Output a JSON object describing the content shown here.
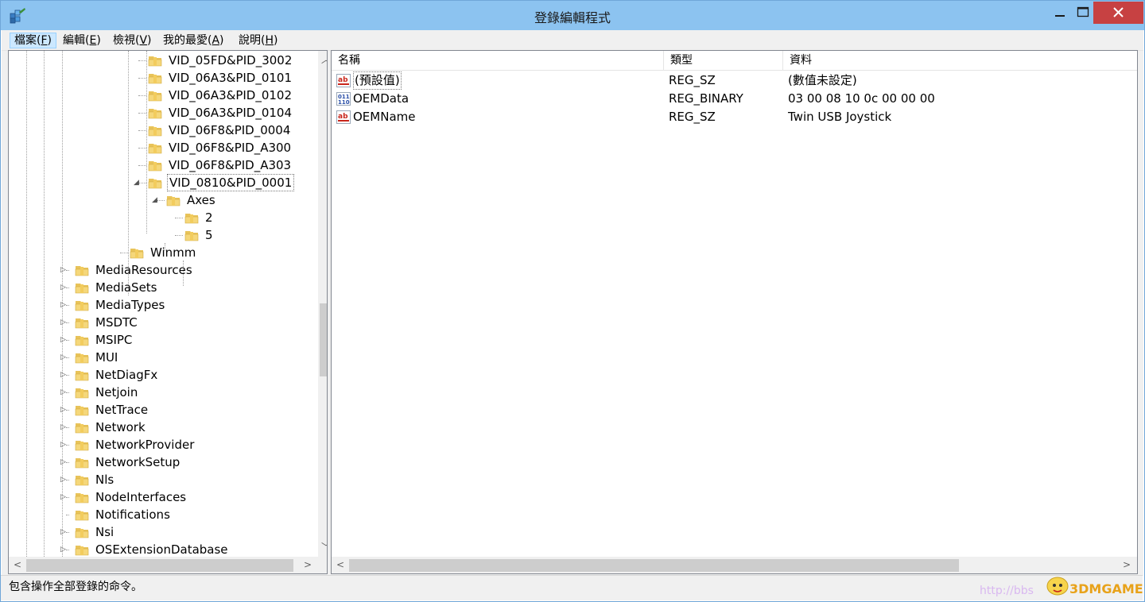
{
  "window": {
    "title": "登錄編輯程式"
  },
  "menu": [
    {
      "label": "檔案(",
      "key": "F",
      "close": ")"
    },
    {
      "label": "編輯(",
      "key": "E",
      "close": ")"
    },
    {
      "label": "檢視(",
      "key": "V",
      "close": ")"
    },
    {
      "label": "我的最愛(",
      "key": "A",
      "close": ")"
    },
    {
      "label": "說明(",
      "key": "H",
      "close": ")"
    }
  ],
  "tree": {
    "items": [
      {
        "label": "VID_05FD&PID_3002",
        "level": 3,
        "expander": ""
      },
      {
        "label": "VID_06A3&PID_0101",
        "level": 3,
        "expander": ""
      },
      {
        "label": "VID_06A3&PID_0102",
        "level": 3,
        "expander": ""
      },
      {
        "label": "VID_06A3&PID_0104",
        "level": 3,
        "expander": ""
      },
      {
        "label": "VID_06F8&PID_0004",
        "level": 3,
        "expander": ""
      },
      {
        "label": "VID_06F8&PID_A300",
        "level": 3,
        "expander": ""
      },
      {
        "label": "VID_06F8&PID_A303",
        "level": 3,
        "expander": ""
      },
      {
        "label": "VID_0810&PID_0001",
        "level": 3,
        "expander": "◢"
      },
      {
        "label": "Axes",
        "level": 4,
        "expander": "◢"
      },
      {
        "label": "2",
        "level": 5,
        "expander": ""
      },
      {
        "label": "5",
        "level": 5,
        "expander": ""
      },
      {
        "label": "Winmm",
        "level": 2,
        "expander": ""
      },
      {
        "label": "MediaResources",
        "level": 1,
        "expander": "▷"
      },
      {
        "label": "MediaSets",
        "level": 1,
        "expander": "▷"
      },
      {
        "label": "MediaTypes",
        "level": 1,
        "expander": "▷"
      },
      {
        "label": "MSDTC",
        "level": 1,
        "expander": "▷"
      },
      {
        "label": "MSIPC",
        "level": 1,
        "expander": "▷"
      },
      {
        "label": "MUI",
        "level": 1,
        "expander": "▷"
      },
      {
        "label": "NetDiagFx",
        "level": 1,
        "expander": "▷"
      },
      {
        "label": "Netjoin",
        "level": 1,
        "expander": "▷"
      },
      {
        "label": "NetTrace",
        "level": 1,
        "expander": "▷"
      },
      {
        "label": "Network",
        "level": 1,
        "expander": "▷"
      },
      {
        "label": "NetworkProvider",
        "level": 1,
        "expander": "▷"
      },
      {
        "label": "NetworkSetup",
        "level": 1,
        "expander": "▷"
      },
      {
        "label": "Nls",
        "level": 1,
        "expander": "▷"
      },
      {
        "label": "NodeInterfaces",
        "level": 1,
        "expander": "▷"
      },
      {
        "label": "Notifications",
        "level": 1,
        "expander": ""
      },
      {
        "label": "Nsi",
        "level": 1,
        "expander": "▷"
      },
      {
        "label": "OSExtensionDatabase",
        "level": 1,
        "expander": "▷"
      }
    ],
    "selected_index": 7
  },
  "list": {
    "columns": [
      "名稱",
      "類型",
      "資料"
    ],
    "rows": [
      {
        "name": "(預設值)",
        "type": "REG_SZ",
        "data": "(數值未設定)",
        "icon": "string-value-icon"
      },
      {
        "name": "OEMData",
        "type": "REG_BINARY",
        "data": "03 00 08 10 0c 00 00 00",
        "icon": "binary-value-icon"
      },
      {
        "name": "OEMName",
        "type": "REG_SZ",
        "data": "Twin USB Joystick",
        "icon": "string-value-icon"
      }
    ]
  },
  "status": {
    "text": "包含操作全部登錄的命令。"
  },
  "watermark": {
    "text": "http://bbs",
    "logo_text": "3DMGAME"
  },
  "colors": {
    "titlebar": "#8cc3f0",
    "close_button": "#c74142",
    "folder": "#f5d77a",
    "menu_active": "#cce8ff"
  }
}
